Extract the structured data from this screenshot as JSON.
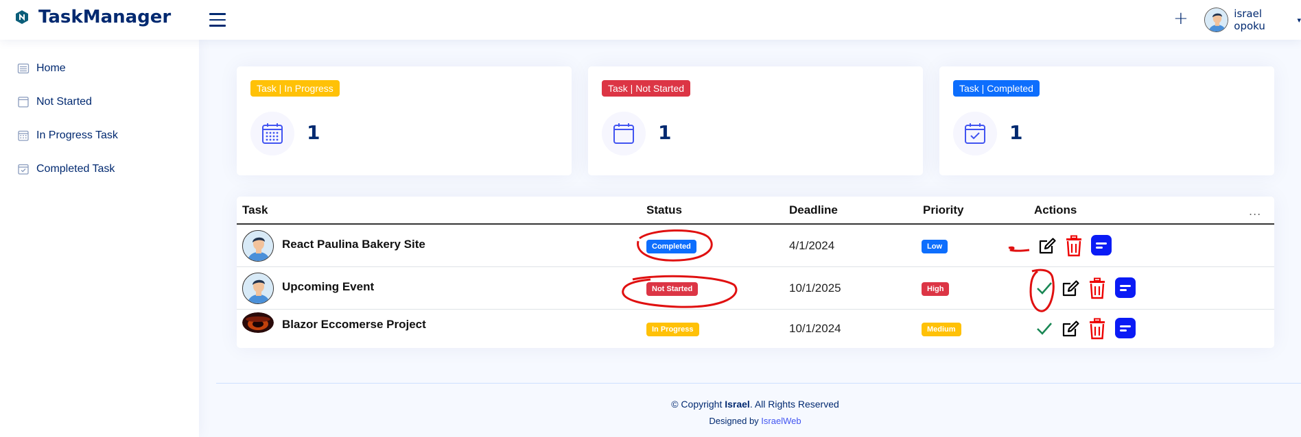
{
  "app": {
    "title": "TaskManager"
  },
  "header": {
    "add_icon": "+",
    "user_name": "israel opoku"
  },
  "sidebar": {
    "items": [
      {
        "label": "Home",
        "icon": "list-icon"
      },
      {
        "label": "Not Started",
        "icon": "window-icon"
      },
      {
        "label": "In Progress Task",
        "icon": "calendar-grid-icon"
      },
      {
        "label": "Completed Task",
        "icon": "calendar-check-icon"
      }
    ]
  },
  "cards": [
    {
      "badge": "Task | In Progress",
      "count": "1",
      "color": "#ffc107",
      "icon": "calendar-grid-icon"
    },
    {
      "badge": "Task | Not Started",
      "count": "1",
      "color": "#dc3545",
      "icon": "calendar-icon"
    },
    {
      "badge": "Task | Completed",
      "count": "1",
      "color": "#0d6efd",
      "icon": "calendar-check-icon"
    }
  ],
  "table": {
    "headers": {
      "task": "Task",
      "status": "Status",
      "deadline": "Deadline",
      "priority": "Priority",
      "actions": "Actions"
    },
    "more": "...",
    "rows": [
      {
        "task": "React Paulina Bakery Site",
        "status": "Completed",
        "status_color": "#0d6efd",
        "deadline": "4/1/2024",
        "priority": "Low",
        "priority_color": "#0d6efd"
      },
      {
        "task": "Upcoming Event",
        "status": "Not Started",
        "status_color": "#dc3545",
        "deadline": "10/1/2025",
        "priority": "High",
        "priority_color": "#dc3545"
      },
      {
        "task": "Blazor Eccomerse Project",
        "status": "In Progress",
        "status_color": "#ffc107",
        "deadline": "10/1/2024",
        "priority": "Medium",
        "priority_color": "#ffc107"
      }
    ]
  },
  "footer": {
    "copyright_prefix": "© Copyright ",
    "copyright_name": "Israel",
    "copyright_suffix": ". All Rights Reserved",
    "designed_by": "Designed by ",
    "designer": "IsraelWeb"
  }
}
